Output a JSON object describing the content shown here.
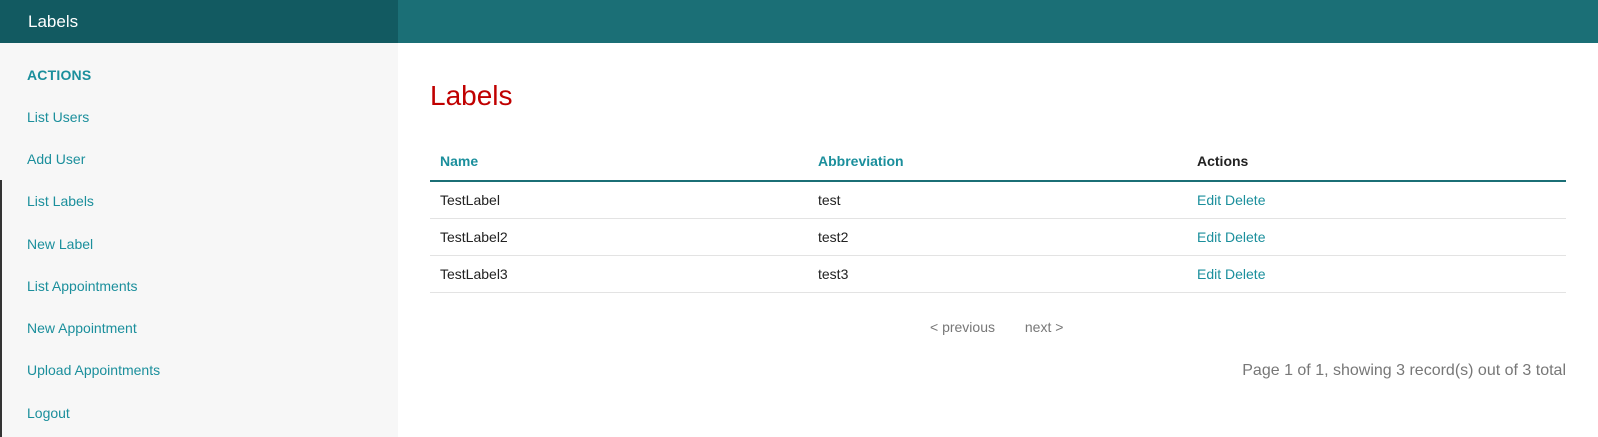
{
  "header": {
    "title": "Labels"
  },
  "sidebar": {
    "heading": "ACTIONS",
    "items": [
      {
        "label": "List Users"
      },
      {
        "label": "Add User"
      },
      {
        "label": "List Labels"
      },
      {
        "label": "New Label"
      },
      {
        "label": "List Appointments"
      },
      {
        "label": "New Appointment"
      },
      {
        "label": "Upload Appointments"
      },
      {
        "label": "Logout"
      }
    ]
  },
  "main": {
    "title": "Labels",
    "table": {
      "headers": {
        "name": "Name",
        "abbreviation": "Abbreviation",
        "actions": "Actions"
      },
      "rows": [
        {
          "name": "TestLabel",
          "abbreviation": "test",
          "edit": "Edit",
          "delete": "Delete"
        },
        {
          "name": "TestLabel2",
          "abbreviation": "test2",
          "edit": "Edit",
          "delete": "Delete"
        },
        {
          "name": "TestLabel3",
          "abbreviation": "test3",
          "edit": "Edit",
          "delete": "Delete"
        }
      ]
    },
    "pagination": {
      "previous": "< previous",
      "next": "next >",
      "counter": "Page 1 of 1, showing 3 record(s) out of 3 total"
    }
  },
  "colors": {
    "topbar": "#1b6f76",
    "topbar_title_bg": "#125a61",
    "link": "#1b8f9c",
    "page_title": "#c00000"
  }
}
